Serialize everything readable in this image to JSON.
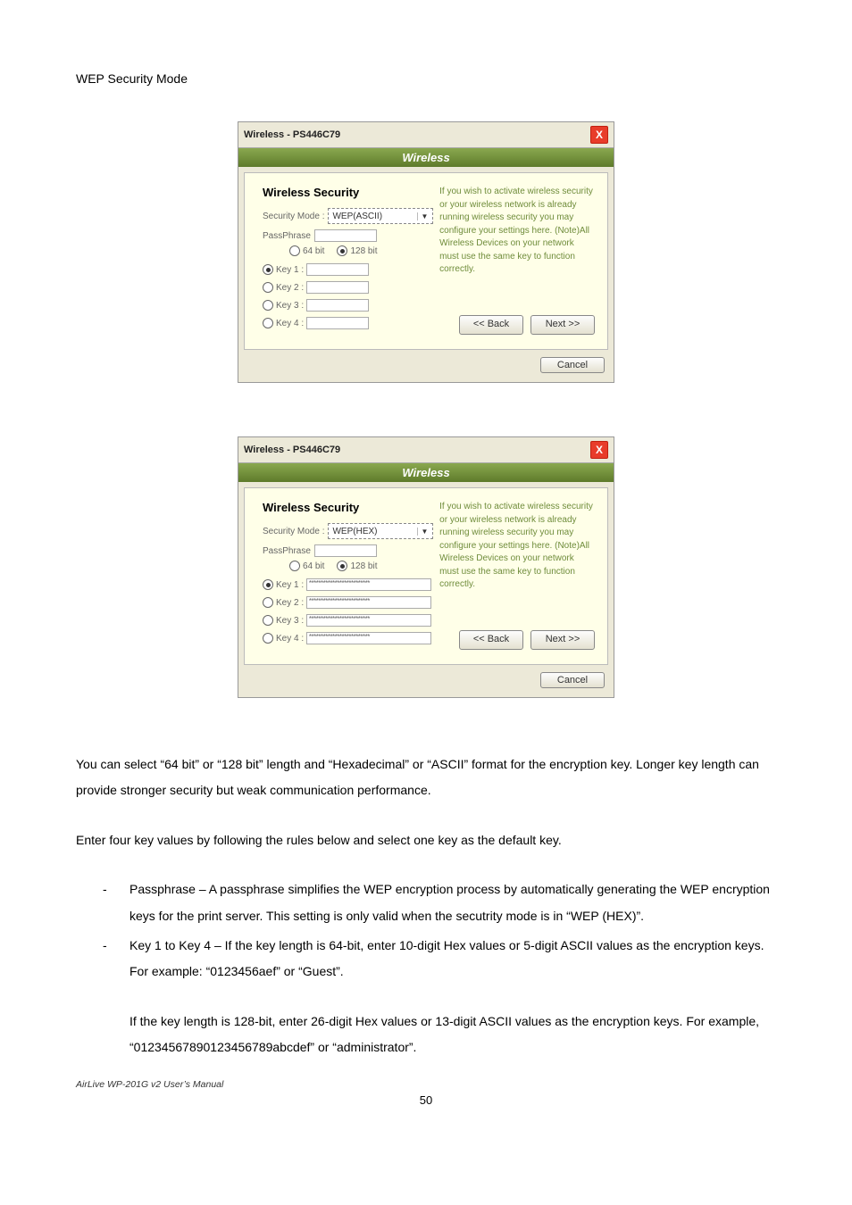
{
  "section_title": "WEP Security Mode",
  "dialog_a": {
    "title": "Wireless - PS446C79",
    "header": "Wireless",
    "heading": "Wireless Security",
    "security_mode_label": "Security Mode :",
    "security_mode_value": "WEP(ASCII)",
    "passphrase_label": "PassPhrase",
    "bits": {
      "opt64": "64 bit",
      "opt128": "128 bit"
    },
    "keys": {
      "k1": "Key 1 :",
      "k2": "Key 2 :",
      "k3": "Key 3 :",
      "k4": "Key 4 :"
    },
    "help_text": "If you wish to activate wireless security or your wireless network is already running wireless security you may configure your settings here. (Note)All Wireless Devices on your network must use the same key to function correctly.",
    "back": "<< Back",
    "next": "Next >>",
    "cancel": "Cancel"
  },
  "dialog_b": {
    "title": "Wireless - PS446C79",
    "header": "Wireless",
    "heading": "Wireless Security",
    "security_mode_label": "Security Mode :",
    "security_mode_value": "WEP(HEX)",
    "passphrase_label": "PassPhrase",
    "bits": {
      "opt64": "64 bit",
      "opt128": "128 bit"
    },
    "keys": {
      "k1": "Key 1 :",
      "k2": "Key 2 :",
      "k3": "Key 3 :",
      "k4": "Key 4 :",
      "mask": "**************************"
    },
    "help_text": "If you wish to activate wireless security or your wireless network is already running wireless security you may configure your settings here. (Note)All Wireless Devices on your network must use the same key to function correctly.",
    "back": "<< Back",
    "next": "Next >>",
    "cancel": "Cancel"
  },
  "para1": "You can select “64 bit” or “128 bit” length and “Hexadecimal” or “ASCII” format for the encryption key. Longer key length can provide stronger security but weak communication performance.",
  "para2": "Enter four key values by following the rules below and select one key as the default key.",
  "bullet1": "Passphrase – A passphrase simplifies the WEP encryption process by automatically generating the WEP encryption keys for the print server. This setting is only valid when the secutrity mode is in “WEP (HEX)”.",
  "bullet2": "Key 1 to Key 4 – If the key length is 64-bit, enter 10-digit Hex values or 5-digit ASCII values as the encryption keys. For example: “0123456aef” or “Guest”.",
  "para3": "If the key length is 128-bit, enter 26-digit Hex values or 13-digit ASCII values as the encryption keys. For example, “01234567890123456789abcdef” or “administrator”.",
  "footer": "AirLive WP-201G v2 User’s Manual",
  "page_number": "50"
}
